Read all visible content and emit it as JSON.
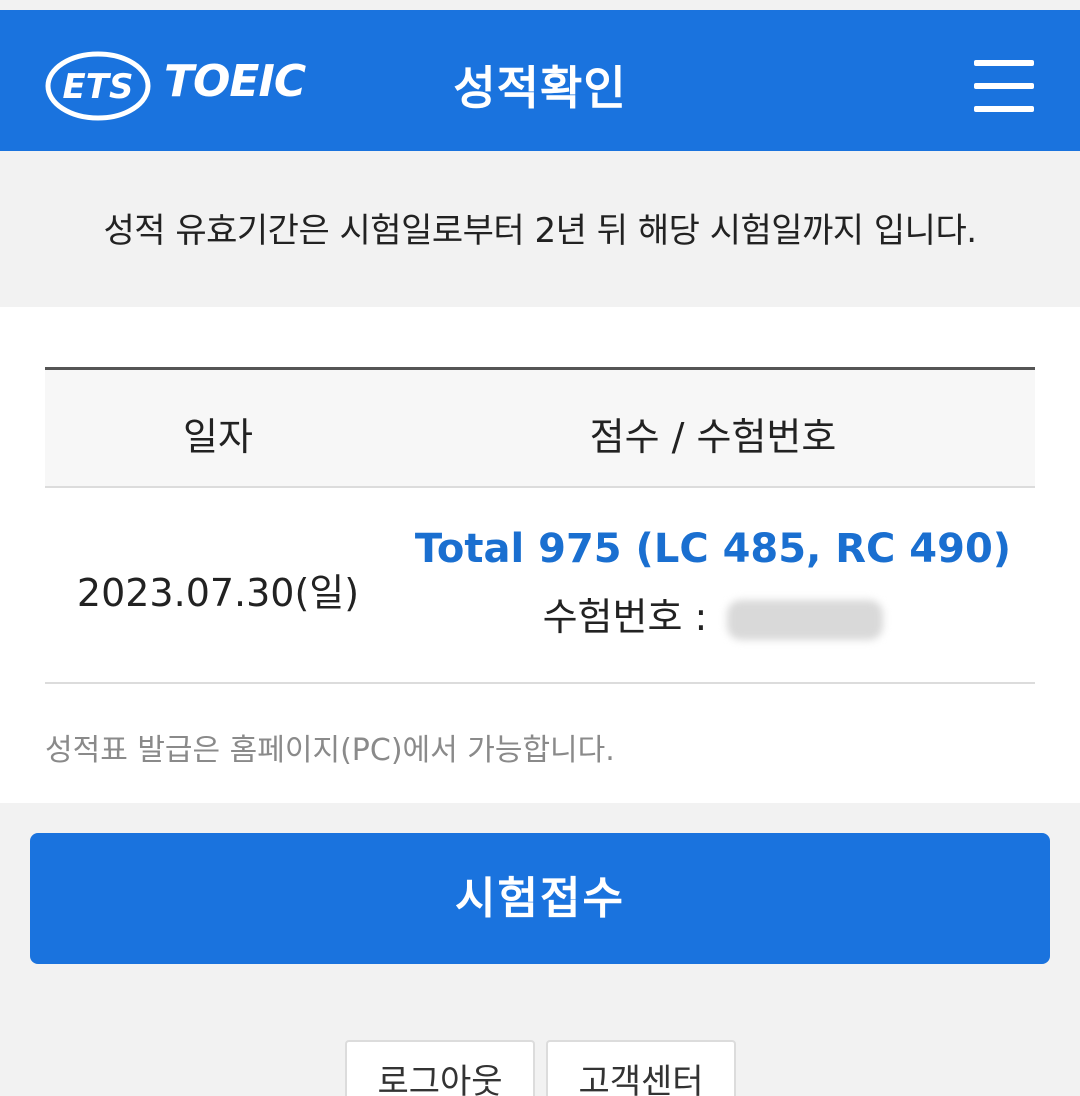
{
  "header": {
    "logo_ets": "ETS",
    "logo_toeic": "TOEIC",
    "title": "성적확인",
    "menu_icon": "hamburger-menu-icon"
  },
  "notice": {
    "text": "성적 유효기간은 시험일로부터 2년 뒤 해당 시험일까지 입니다."
  },
  "score_table": {
    "columns": [
      "일자",
      "점수 / 수험번호"
    ],
    "rows": [
      {
        "date": "2023.07.30(일)",
        "score": "Total 975 (LC 485, RC 490)",
        "reg_label": "수험번호 :"
      }
    ]
  },
  "issue_note": "성적표 발급은 홈페이지(PC)에서 가능합니다.",
  "apply_button": "시험접수",
  "footer": {
    "logout": "로그아웃",
    "support": "고객센터"
  },
  "colors": {
    "brand_blue": "#1a73de",
    "score_blue": "#1a6fd0",
    "background": "#f2f2f2"
  }
}
